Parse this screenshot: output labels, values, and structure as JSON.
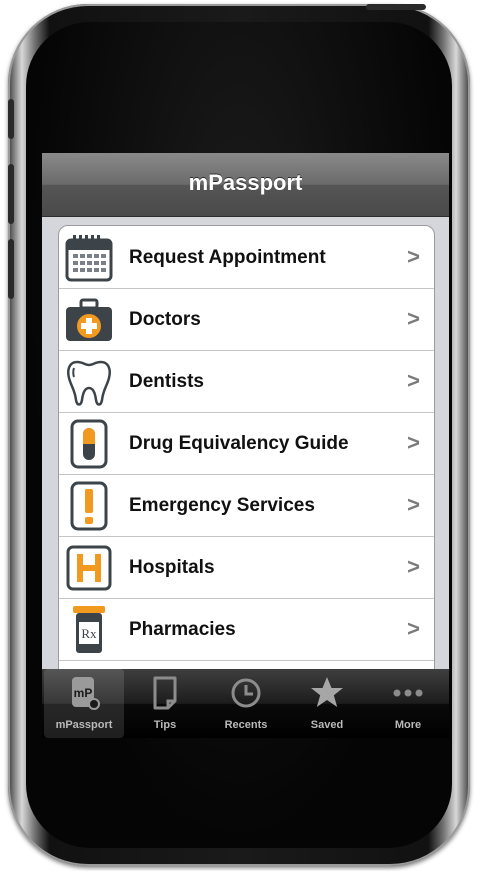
{
  "app": {
    "title": "mPassport"
  },
  "menu": [
    {
      "label": "Request Appointment",
      "icon": "calendar-icon"
    },
    {
      "label": "Doctors",
      "icon": "medical-kit-icon"
    },
    {
      "label": "Dentists",
      "icon": "tooth-icon"
    },
    {
      "label": "Drug Equivalency Guide",
      "icon": "pill-icon"
    },
    {
      "label": "Emergency Services",
      "icon": "exclamation-icon"
    },
    {
      "label": "Hospitals",
      "icon": "hospital-h-icon"
    },
    {
      "label": "Pharmacies",
      "icon": "prescription-bottle-icon"
    }
  ],
  "chevron": ">",
  "tabs": [
    {
      "label": "mPassport",
      "icon": "mpassport-logo-icon"
    },
    {
      "label": "Tips",
      "icon": "document-icon"
    },
    {
      "label": "Recents",
      "icon": "clock-icon"
    },
    {
      "label": "Saved",
      "icon": "star-icon"
    },
    {
      "label": "More",
      "icon": "more-dots-icon"
    }
  ],
  "colors": {
    "accent": "#f29a1f",
    "icon_gray": "#3c444a",
    "navbar": "#5a5a5a"
  }
}
